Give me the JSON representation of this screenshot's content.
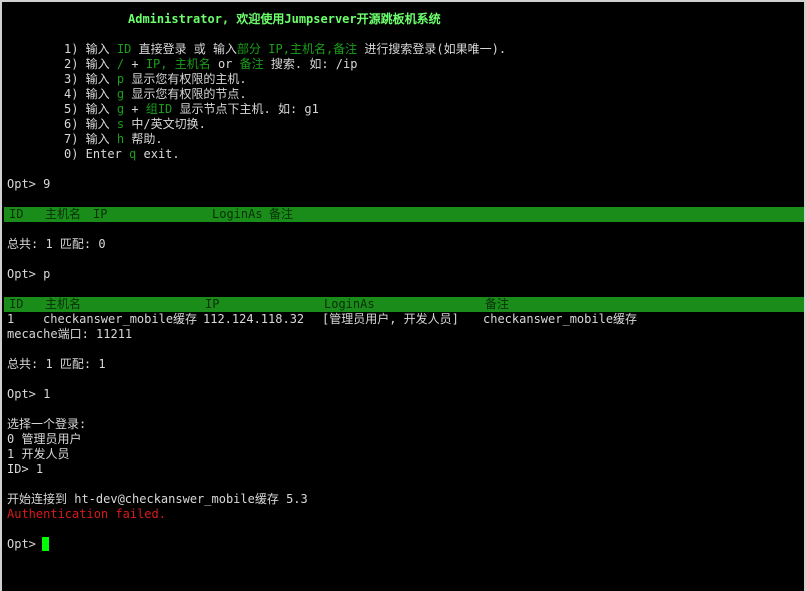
{
  "welcome": "Administrator, 欢迎使用Jumpserver开源跳板机系统",
  "menu": [
    {
      "n": "1) 输入 ",
      "a": "ID",
      "b": " 直接登录 或 输入",
      "c": "部分 IP,主机名,备注",
      "d": " 进行搜索登录(如果唯一)."
    },
    {
      "n": "2) 输入 ",
      "a": "/",
      "b": " + ",
      "c": "IP, 主机名",
      "d": " or ",
      "e": "备注",
      "f": " 搜索. 如: /ip"
    },
    {
      "n": "3) 输入 ",
      "a": "p",
      "b": " 显示您有权限的主机."
    },
    {
      "n": "4) 输入 ",
      "a": "g",
      "b": " 显示您有权限的节点."
    },
    {
      "n": "5) 输入 ",
      "a": "g",
      "b": " + ",
      "c": "组ID",
      "d": " 显示节点下主机. 如: g1"
    },
    {
      "n": "6) 输入 ",
      "a": "s",
      "b": " 中/英文切换."
    },
    {
      "n": "7) 输入 ",
      "a": "h",
      "b": " 帮助."
    },
    {
      "n": "0) Enter ",
      "a": "q",
      "b": " exit."
    }
  ],
  "session": {
    "prompt1": "Opt> 9",
    "header1": {
      "id": "ID",
      "hostname": "主机名",
      "ip": "IP",
      "loginas": "LoginAs",
      "comment": "备注"
    },
    "summary1": "总共: 1 匹配: 0",
    "prompt2": "Opt> p",
    "header2": {
      "id": "ID",
      "hostname": "主机名",
      "ip": "IP",
      "loginas": "LoginAs",
      "comment": "备注"
    },
    "row": {
      "id": "1",
      "hostname": "checkanswer_mobile缓存",
      "ip": "112.124.118.32",
      "loginas": "[管理员用户, 开发人员]",
      "comment": "checkanswer_mobile缓存"
    },
    "row_wrap": "mecache端口: 11211",
    "summary2": "总共: 1 匹配: 1",
    "prompt3": "Opt> 1",
    "choose": "选择一个登录:",
    "option0": "0 管理员用户",
    "option1": "1 开发人员",
    "id_prompt": "ID> 1",
    "connecting": "开始连接到 ht-dev@checkanswer_mobile缓存 5.3",
    "error": "Authentication failed.",
    "prompt_final": "Opt>"
  },
  "colors": {
    "background": "#000000",
    "text": "#d8d8d8",
    "title": "#6cff6c",
    "highlight": "#1a9e1a",
    "header_bar": "#198c19",
    "error": "#d81a1a",
    "cursor": "#00ff00"
  }
}
